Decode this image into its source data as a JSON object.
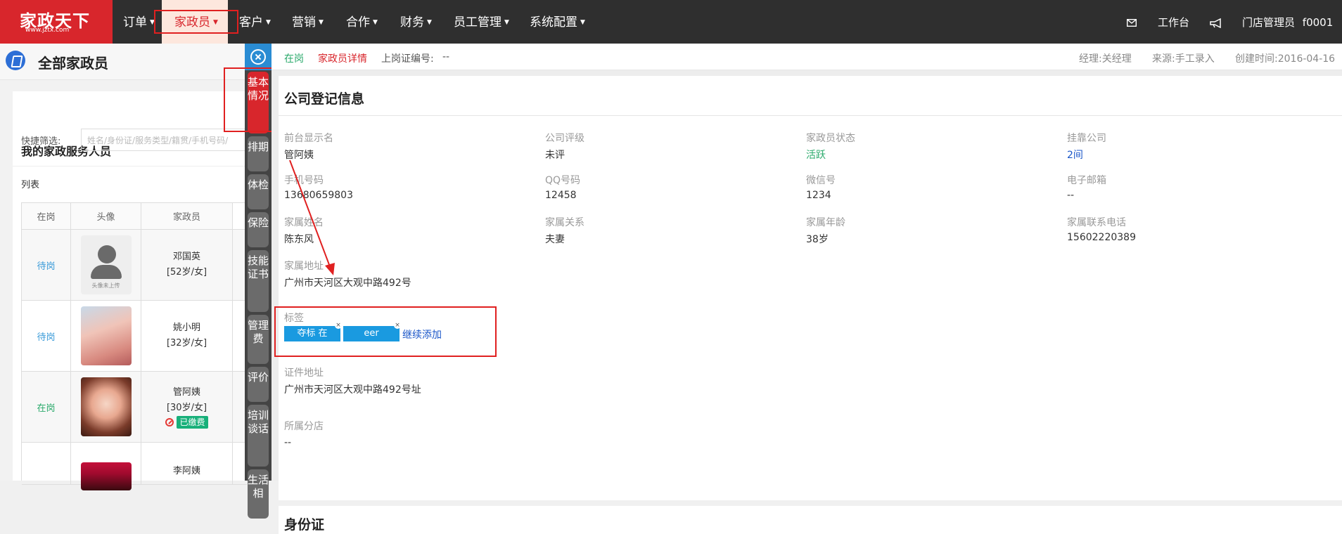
{
  "topnav": {
    "logo_text": "家政天下",
    "logo_url_text": "www.jztx.com",
    "items": [
      {
        "label": "订单"
      },
      {
        "label": "家政员"
      },
      {
        "label": "客户"
      },
      {
        "label": "营销"
      },
      {
        "label": "合作"
      },
      {
        "label": "财务"
      },
      {
        "label": "员工管理"
      },
      {
        "label": "系统配置"
      }
    ],
    "workbench": "工作台",
    "user": "门店管理员",
    "user_id": "f0001"
  },
  "left_panel": {
    "title": "全部家政员",
    "section_title": "我的家政服务人员",
    "quick_filter_label": "快捷筛选:",
    "quick_filter_placeholder": "姓名/身份证/服务类型/籍贯/手机号码/",
    "list_label": "列表",
    "columns": [
      "在岗",
      "头像",
      "家政员"
    ],
    "rows": [
      {
        "status": "待岗",
        "name": "邓国英",
        "meta": "[52岁/女]",
        "avatar_caption": "头像未上传",
        "paid": ""
      },
      {
        "status": "待岗",
        "name": "姚小明",
        "meta": "[32岁/女]",
        "avatar_caption": "",
        "paid": ""
      },
      {
        "status": "在岗",
        "name": "管阿姨",
        "meta": "[30岁/女]",
        "avatar_caption": "",
        "paid": "已缴费"
      },
      {
        "status": "",
        "name": "李阿姨",
        "meta": "",
        "avatar_caption": "",
        "paid": ""
      }
    ]
  },
  "vtabs": [
    "基本情况",
    "排期",
    "体检",
    "保险",
    "技能证书",
    "管理费",
    "评价",
    "培训谈话",
    "生活相"
  ],
  "infobar": {
    "status": "在岗",
    "detail_link": "家政员详情",
    "license_label": "上岗证编号:",
    "license_value": "--",
    "manager": "经理:关经理",
    "source": "来源:手工录入",
    "created": "创建时间:2016-04-16"
  },
  "company_info": {
    "title": "公司登记信息",
    "fields": [
      {
        "label": "前台显示名",
        "value": "管阿姨"
      },
      {
        "label": "公司评级",
        "value": "未评"
      },
      {
        "label": "家政员状态",
        "value": "活跃"
      },
      {
        "label": "挂靠公司",
        "value": "2间"
      },
      {
        "label": "手机号码",
        "value": "13680659803"
      },
      {
        "label": "QQ号码",
        "value": "12458"
      },
      {
        "label": "微信号",
        "value": "1234"
      },
      {
        "label": "电子邮箱",
        "value": "--"
      },
      {
        "label": "家属姓名",
        "value": "陈东风"
      },
      {
        "label": "家属关系",
        "value": "夫妻"
      },
      {
        "label": "家属年龄",
        "value": "38岁"
      },
      {
        "label": "家属联系电话",
        "value": "15602220389"
      }
    ],
    "address_label": "家属地址",
    "address_value": "广州市天河区大观中路492号",
    "tags_label": "标签",
    "tags": [
      "夺标 在",
      "eer"
    ],
    "add_tag": "继续添加",
    "cert_address_label": "证件地址",
    "cert_address_value": "广州市天河区大观中路492号址",
    "branch_label": "所属分店",
    "branch_value": "--"
  },
  "id_section_title": "身份证",
  "colors": {
    "brand_red": "#d8262c",
    "topbar": "#2f2f2f",
    "accent_blue": "#1a9ae0",
    "status_green": "#2aaa6b"
  }
}
